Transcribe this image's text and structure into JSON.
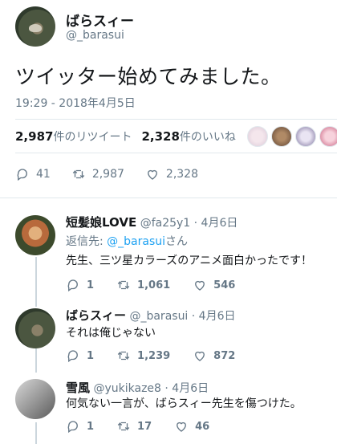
{
  "tweet": {
    "display_name": "ばらスィー",
    "handle": "@_barasui",
    "text": "ツイッター始めてみました。",
    "timestamp": "19:29 - 2018年4月5日",
    "retweets_count": "2,987",
    "retweets_label": "件のリツイート",
    "likes_count": "2,328",
    "likes_label": "件のいいね",
    "actions": {
      "replies": "41",
      "retweets": "2,987",
      "likes": "2,328"
    }
  },
  "replies": [
    {
      "display_name": "短髪娘LOVE",
      "handle": "@fa25y1",
      "date": "· 4月6日",
      "reply_to_prefix": "返信先: ",
      "reply_to_handle": "@_barasui",
      "reply_to_suffix": "さん",
      "text": "先生、三ツ星カラーズのアニメ面白かったです！",
      "actions": {
        "replies": "1",
        "retweets": "1,061",
        "likes": "546"
      }
    },
    {
      "display_name": "ばらスィー",
      "handle": "@_barasui",
      "date": "· 4月6日",
      "text": "それは俺じゃない",
      "actions": {
        "replies": "1",
        "retweets": "1,239",
        "likes": "872"
      }
    },
    {
      "display_name": "雪風",
      "handle": "@yukikaze8",
      "date": "· 4月6日",
      "text": "何気ない一言が、ばらスィー先生を傷つけた。",
      "actions": {
        "replies": "1",
        "retweets": "17",
        "likes": "46"
      }
    }
  ],
  "icons": [
    "reply-icon",
    "retweet-icon",
    "heart-icon"
  ],
  "colors": {
    "accent": "#1da1f2",
    "muted": "#657786",
    "text": "#14171a"
  }
}
